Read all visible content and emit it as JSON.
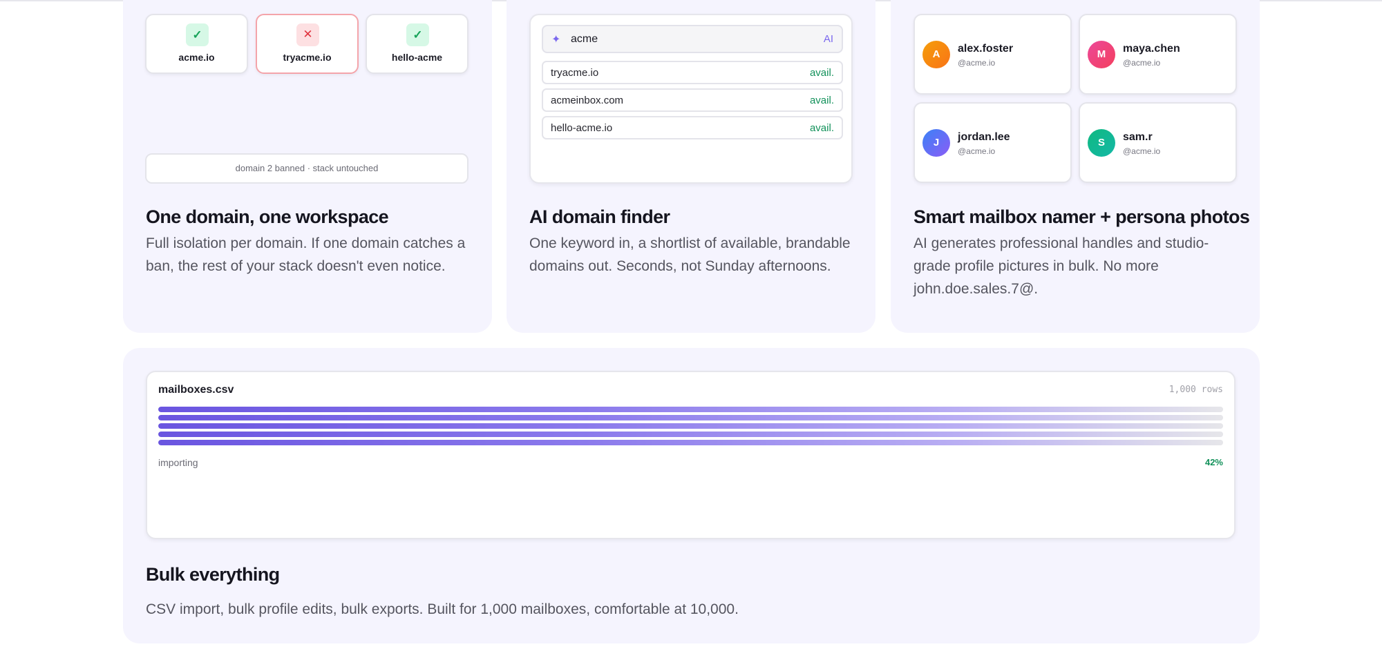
{
  "isolation_card": {
    "domains": [
      {
        "name": "acme.io",
        "state": "ok",
        "icon": "check-icon",
        "glyph": "✓"
      },
      {
        "name": "tryacme.io",
        "state": "banned",
        "icon": "close-icon",
        "glyph": "✕"
      },
      {
        "name": "hello-acme",
        "state": "ok",
        "icon": "check-icon",
        "glyph": "✓"
      }
    ],
    "note": "domain 2 banned · stack untouched",
    "title": "One domain, one workspace",
    "description": "Full isolation per domain. If one domain catches a ban, the rest of your stack doesn't even notice."
  },
  "finder_card": {
    "search": {
      "icon": "sparkle-icon",
      "glyph": "✦",
      "value": "acme",
      "tag": "AI"
    },
    "results": [
      {
        "domain": "tryacme.io",
        "status": "avail."
      },
      {
        "domain": "acmeinbox.com",
        "status": "avail."
      },
      {
        "domain": "hello-acme.io",
        "status": "avail."
      }
    ],
    "title": "AI domain finder",
    "description": "One keyword in, a shortlist of available, brandable domains out. Seconds, not Sunday afternoons."
  },
  "namer_card": {
    "personas": [
      {
        "initial": "A",
        "name": "alex.foster",
        "handle": "@acme.io",
        "color": "#f59e0b"
      },
      {
        "initial": "M",
        "name": "maya.chen",
        "handle": "@acme.io",
        "color": "#ec4899"
      },
      {
        "initial": "J",
        "name": "jordan.lee",
        "handle": "@acme.io",
        "color": "#6366f1"
      },
      {
        "initial": "S",
        "name": "sam.r",
        "handle": "@acme.io",
        "color": "#10b981"
      }
    ],
    "title": "Smart mailbox namer + persona photos",
    "description": "AI generates professional handles and studio-grade profile pictures in bulk. No more john.doe.sales.7@."
  },
  "bulk_card": {
    "file_name": "mailboxes.csv",
    "row_count": "1,000 rows",
    "status": "importing",
    "progress_label": "42%",
    "progress": 0.42,
    "title": "Bulk everything",
    "description": "CSV import, bulk profile edits, bulk exports. Built for 1,000 mailboxes, comfortable at 10,000."
  }
}
